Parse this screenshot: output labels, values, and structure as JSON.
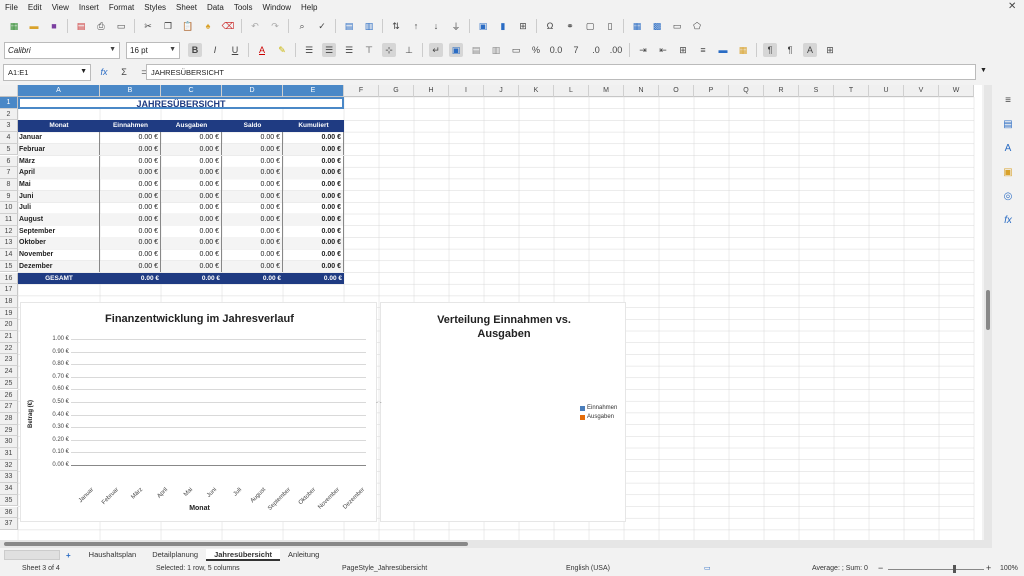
{
  "menu": [
    "File",
    "Edit",
    "View",
    "Insert",
    "Format",
    "Styles",
    "Sheet",
    "Data",
    "Tools",
    "Window",
    "Help"
  ],
  "font_name": "Calibri",
  "font_size": "16 pt",
  "name_box": "A1:E1",
  "formula_content": "JAHRESÜBERSICHT",
  "columns": [
    "A",
    "B",
    "C",
    "D",
    "E",
    "F",
    "G",
    "H",
    "I",
    "J",
    "K",
    "L",
    "M",
    "N",
    "O",
    "P",
    "Q",
    "R",
    "S",
    "T",
    "U",
    "V",
    "W"
  ],
  "sheet": {
    "title": "JAHRESÜBERSICHT",
    "headers": [
      "Monat",
      "Einnahmen",
      "Ausgaben",
      "Saldo",
      "Kumuliert"
    ],
    "rows": [
      [
        "Januar",
        "0.00 €",
        "0.00 €",
        "0.00 €",
        "0.00 €"
      ],
      [
        "Februar",
        "0.00 €",
        "0.00 €",
        "0.00 €",
        "0.00 €"
      ],
      [
        "März",
        "0.00 €",
        "0.00 €",
        "0.00 €",
        "0.00 €"
      ],
      [
        "April",
        "0.00 €",
        "0.00 €",
        "0.00 €",
        "0.00 €"
      ],
      [
        "Mai",
        "0.00 €",
        "0.00 €",
        "0.00 €",
        "0.00 €"
      ],
      [
        "Juni",
        "0.00 €",
        "0.00 €",
        "0.00 €",
        "0.00 €"
      ],
      [
        "Juli",
        "0.00 €",
        "0.00 €",
        "0.00 €",
        "0.00 €"
      ],
      [
        "August",
        "0.00 €",
        "0.00 €",
        "0.00 €",
        "0.00 €"
      ],
      [
        "September",
        "0.00 €",
        "0.00 €",
        "0.00 €",
        "0.00 €"
      ],
      [
        "Oktober",
        "0.00 €",
        "0.00 €",
        "0.00 €",
        "0.00 €"
      ],
      [
        "November",
        "0.00 €",
        "0.00 €",
        "0.00 €",
        "0.00 €"
      ],
      [
        "Dezember",
        "0.00 €",
        "0.00 €",
        "0.00 €",
        "0.00 €"
      ]
    ],
    "total": [
      "GESAMT",
      "0.00 €",
      "0.00 €",
      "0.00 €",
      "0.00 €"
    ]
  },
  "charts": {
    "line": {
      "title": "Finanzentwicklung im Jahresverlauf",
      "ylabel": "Betrag (€)",
      "xlabel": "Monat",
      "yticks": [
        "1.00 €",
        "0.90 €",
        "0.80 €",
        "0.70 €",
        "0.60 €",
        "0.50 €",
        "0.40 €",
        "0.30 €",
        "0.20 €",
        "0.10 €",
        "0.00 €"
      ],
      "categories": [
        "Januar",
        "Februar",
        "März",
        "April",
        "Mai",
        "Juni",
        "Juli",
        "August",
        "September",
        "Oktober",
        "November",
        "Dezember"
      ]
    },
    "pie": {
      "title_line1": "Verteilung Einnahmen vs.",
      "title_line2": "Ausgaben",
      "legend": [
        {
          "label": "Einnahmen",
          "color": "#4a7ebb"
        },
        {
          "label": "Ausgaben",
          "color": "#e46c0a"
        }
      ]
    }
  },
  "tabs": [
    "Haushaltsplan",
    "Detailplanung",
    "Jahresübersicht",
    "Anleitung"
  ],
  "active_tab": "Jahresübersicht",
  "status": {
    "sheet": "Sheet 3 of 4",
    "selection": "Selected: 1 row, 5 columns",
    "pagestyle": "PageStyle_Jahresübersicht",
    "language": "English (USA)",
    "summary": "Average: ; Sum: 0",
    "zoom": "100%"
  },
  "colors": {
    "header_bg": "#1f3b82",
    "selection_bg": "#4a88c7",
    "accent": "#2a6cc4"
  }
}
